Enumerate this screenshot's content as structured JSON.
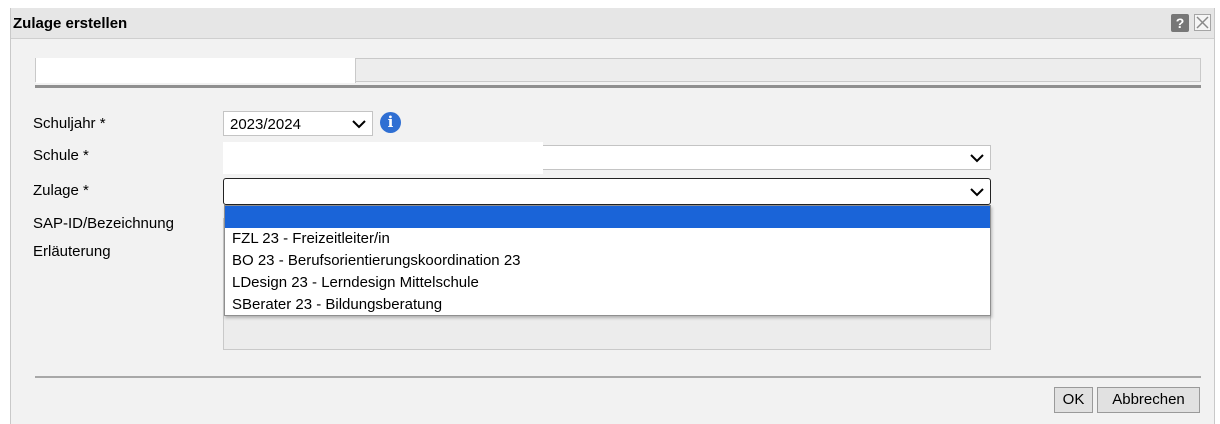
{
  "dialog": {
    "title": "Zulage erstellen",
    "help_icon": "question-icon",
    "close_icon": "close-icon"
  },
  "form": {
    "school_year_label": "Schuljahr *",
    "school_year_value": "2023/2024",
    "info_icon": "info-icon",
    "school_label": "Schule *",
    "school_value": "",
    "allowance_label": "Zulage *",
    "allowance_value": "",
    "sap_label": "SAP-ID/Bezeichnung",
    "explanation_label": "Erläuterung"
  },
  "dropdown": {
    "options": [
      "",
      "FZL 23 - Freizeitleiter/in",
      "BO 23 - Berufsorientierungskoordination 23",
      "LDesign 23 - Lerndesign Mittelschule",
      "SBerater 23 - Bildungsberatung"
    ],
    "selected_index": 0
  },
  "buttons": {
    "ok": "OK",
    "cancel": "Abbrechen"
  },
  "colors": {
    "selection": "#1a64d8",
    "info": "#2f6fd3"
  }
}
